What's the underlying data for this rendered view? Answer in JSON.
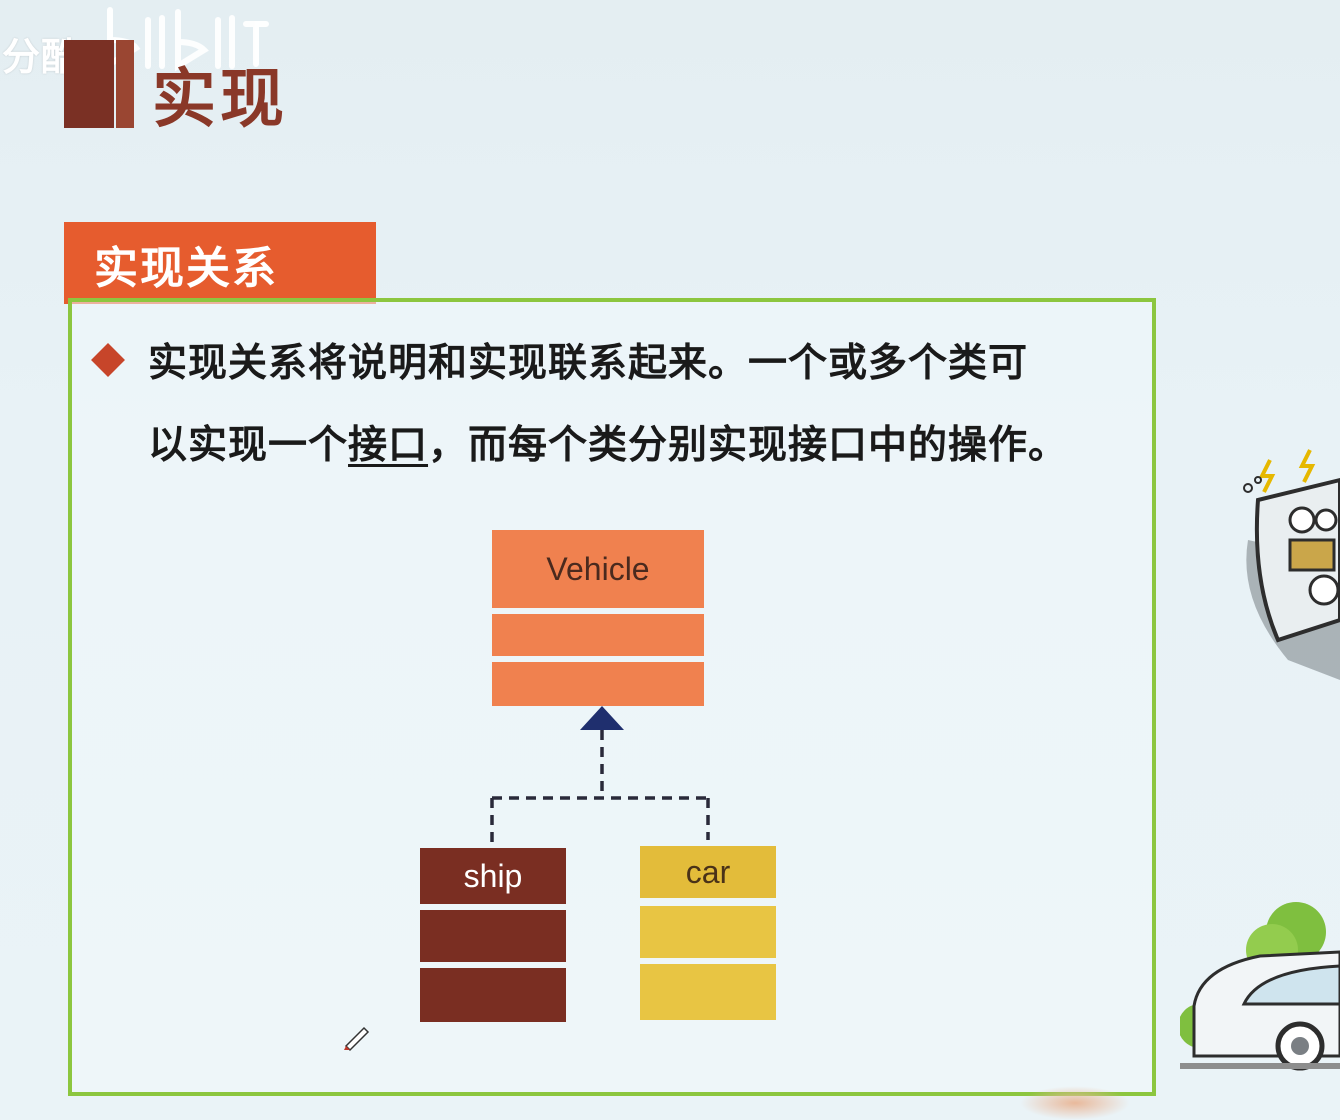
{
  "watermark": {
    "text": "分酷"
  },
  "title": "实现",
  "section_tab": "实现关系",
  "bullet": {
    "line1": "实现关系将说明和实现联系起来。一个或多个类可",
    "line2_before": "以实现一个",
    "line2_underlined": "接口",
    "line2_after": "，而每个类分别实现接口中的操作。"
  },
  "diagram": {
    "interface_name": "Vehicle",
    "classes": [
      "ship",
      "car"
    ]
  },
  "colors": {
    "title_dark": "#7a3024",
    "tab_orange": "#e65c2e",
    "box_border_green": "#8cc63f",
    "vehicle_orange": "#f0814f",
    "ship_brown": "#7a2e22",
    "car_yellow": "#e8c543",
    "arrow_navy": "#1f2f6e"
  }
}
